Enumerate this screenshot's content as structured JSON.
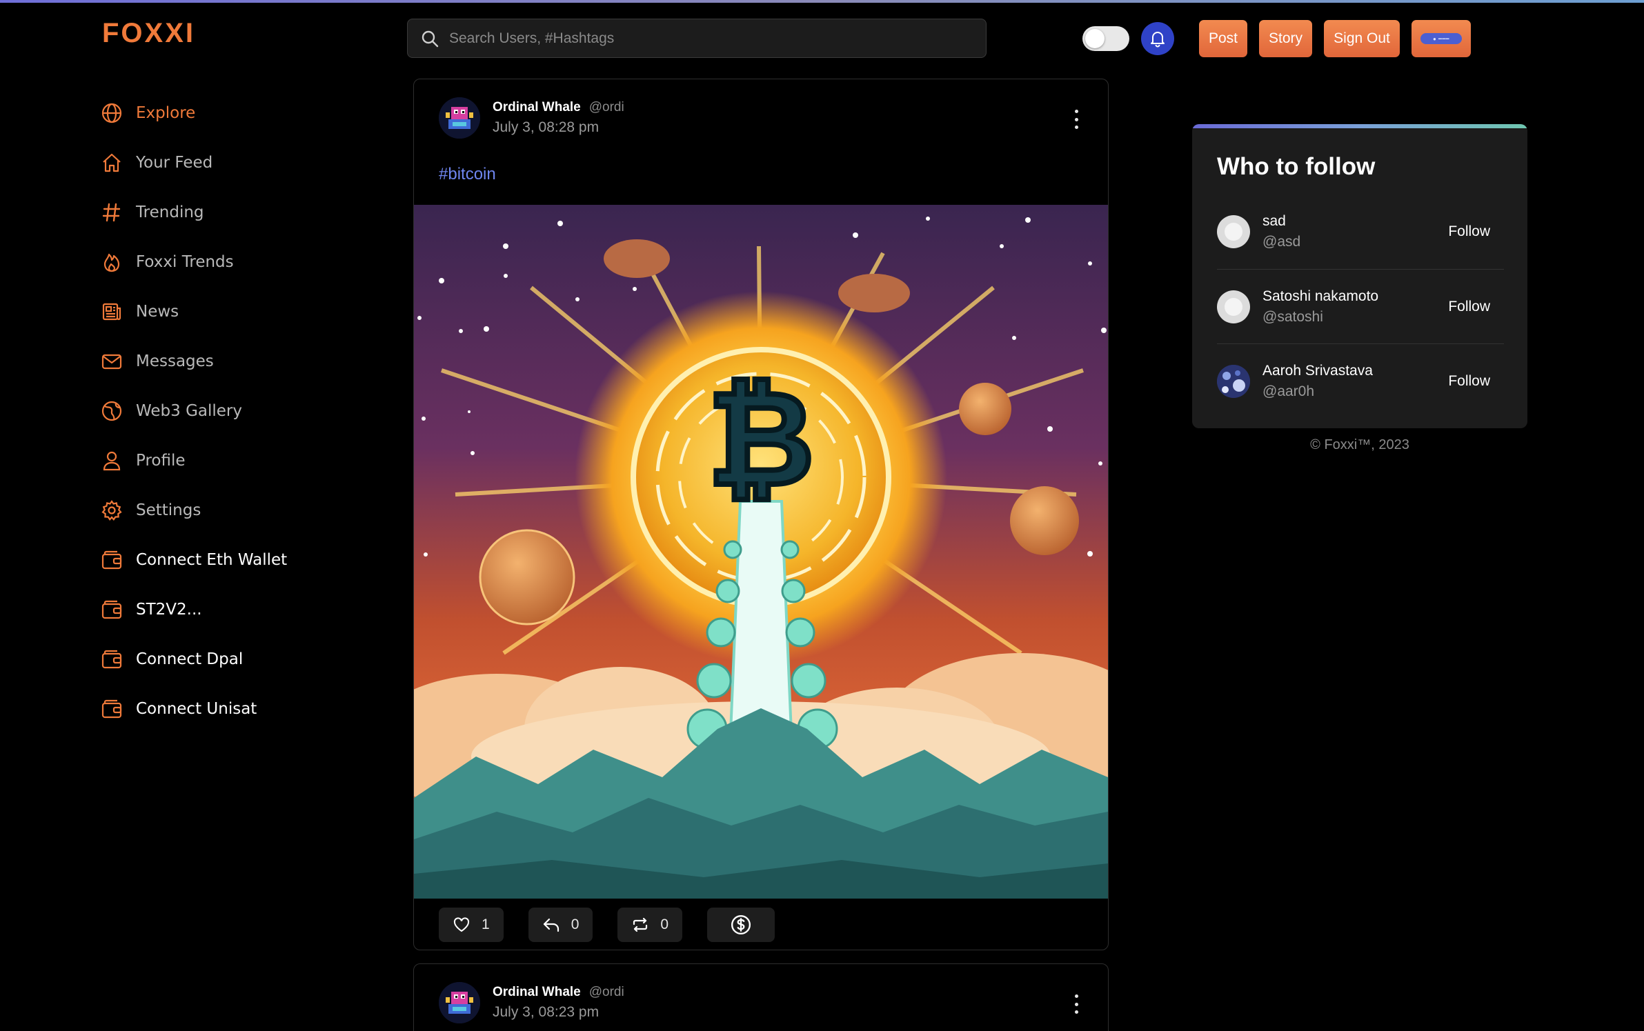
{
  "app": {
    "logo": "FOXXI",
    "accent": "#f07a3a"
  },
  "search": {
    "placeholder": "Search Users, #Hashtags"
  },
  "header": {
    "post_label": "Post",
    "story_label": "Story",
    "signout_label": "Sign Out",
    "theme_toggle_on": false
  },
  "sidebar": {
    "items": [
      {
        "label": "Explore",
        "icon": "globe-icon",
        "active": true
      },
      {
        "label": "Your Feed",
        "icon": "home-icon"
      },
      {
        "label": "Trending",
        "icon": "hash-icon"
      },
      {
        "label": "Foxxi Trends",
        "icon": "flame-icon"
      },
      {
        "label": "News",
        "icon": "newspaper-icon"
      },
      {
        "label": "Messages",
        "icon": "mail-icon"
      },
      {
        "label": "Web3 Gallery",
        "icon": "web3-icon"
      },
      {
        "label": "Profile",
        "icon": "user-icon"
      },
      {
        "label": "Settings",
        "icon": "gear-icon"
      },
      {
        "label": "Connect Eth Wallet",
        "icon": "wallet-icon"
      },
      {
        "label": "ST2V2...",
        "icon": "wallet-icon"
      },
      {
        "label": "Connect Dpal",
        "icon": "wallet-icon"
      },
      {
        "label": "Connect Unisat",
        "icon": "wallet-icon"
      }
    ]
  },
  "feed": {
    "posts": [
      {
        "name": "Ordinal Whale",
        "handle": "@ordi",
        "date": "July 3, 08:28 pm",
        "hashtag": "#bitcoin",
        "likes": "1",
        "replies": "0",
        "reposts": "0"
      },
      {
        "name": "Ordinal Whale",
        "handle": "@ordi",
        "date": "July 3, 08:23 pm"
      }
    ]
  },
  "who_to_follow": {
    "title": "Who to follow",
    "users": [
      {
        "name": "sad",
        "handle": "@asd",
        "button": "Follow"
      },
      {
        "name": "Satoshi nakamoto",
        "handle": "@satoshi",
        "button": "Follow"
      },
      {
        "name": "Aaroh Srivastava",
        "handle": "@aar0h",
        "button": "Follow"
      }
    ]
  },
  "footer": {
    "copyright": "© Foxxi™, 2023"
  }
}
